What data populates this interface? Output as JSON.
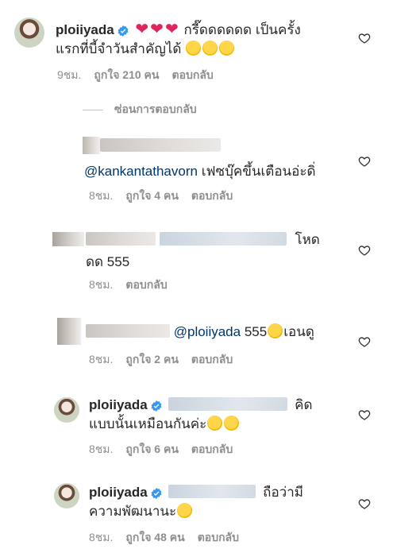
{
  "comments": [
    {
      "username": "ploiiyada",
      "text": "กรี๊ดดดดดด เป็นครั้งแรกที่บี้จำวันสำคัญได้",
      "text_line1": "กรี๊ดดดดดด เป็นครั้ง",
      "text_line2": "แรกที่บี้จำวันสำคัญได้",
      "time": "9ชม.",
      "likes": "ถูกใจ 210 คน",
      "reply": "ตอบกลับ"
    },
    {
      "username": "",
      "mention": "@kankantathavorn",
      "text": "เฟซบุ๊คขึ้นเตือนอ่ะดิ่",
      "time": "8ชม.",
      "likes": "ถูกใจ 4 คน",
      "reply": "ตอบกลับ"
    },
    {
      "username": "",
      "text_line1": "โหด",
      "text_line2": "ดด 555",
      "time": "8ชม.",
      "reply": "ตอบกลับ"
    },
    {
      "username": "",
      "mention": "@ploiiyada",
      "text": "555",
      "text_after": "เอนดู",
      "time": "8ชม.",
      "likes": "ถูกใจ 2 คน",
      "reply": "ตอบกลับ"
    },
    {
      "username": "ploiiyada",
      "text_line1": "คิด",
      "text_line2": "แบบนั้นเหมือนกันค่ะ",
      "time": "8ชม.",
      "likes": "ถูกใจ 6 คน",
      "reply": "ตอบกลับ"
    },
    {
      "username": "ploiiyada",
      "text_line1": "ถือว่ามี",
      "text_line2": "ความพัฒนานะ",
      "time": "8ชม.",
      "likes": "ถูกใจ 48 คน",
      "reply": "ตอบกลับ"
    }
  ],
  "hide_replies_label": "ซ่อนการตอบกลับ",
  "icons": {
    "verified": "verified-badge-icon",
    "like": "heart-outline-icon",
    "heart_emoji": "red-heart-emoji",
    "love_emoji": "heart-eyes-emoji",
    "laugh_emoji": "rofl-emoji"
  },
  "colors": {
    "text": "#262626",
    "meta": "#8e8e8e",
    "verified": "#3897f0",
    "mention": "#003569",
    "heart_emoji": "#e0245e"
  }
}
